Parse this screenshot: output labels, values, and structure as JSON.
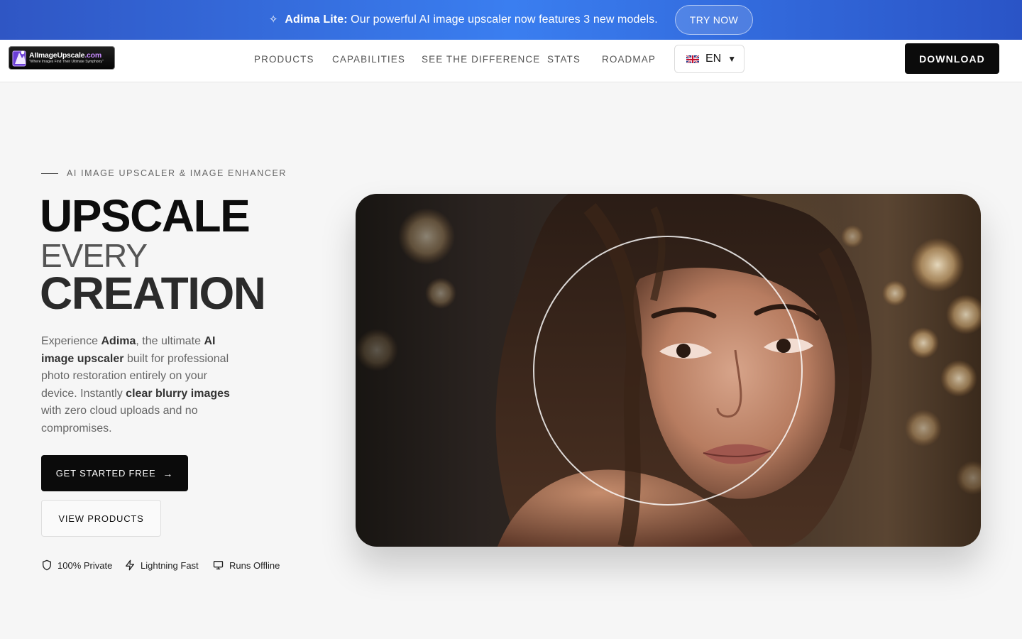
{
  "banner": {
    "icon": "sparkle-icon",
    "highlight": "Adima Lite:",
    "message": " Our powerful AI image upscaler now features 3 new models.",
    "cta": "TRY NOW"
  },
  "header": {
    "logo": {
      "name_main": "AIImageUpscale",
      "name_suffix": ".com",
      "tagline": "\"Where Images Find Their Ultimate Symphony\""
    },
    "nav": [
      "PRODUCTS",
      "CAPABILITIES",
      "SEE THE DIFFERENCE",
      "STATS",
      "ROADMAP"
    ],
    "language": {
      "flag": "uk-flag-icon",
      "code": "EN"
    },
    "download": "DOWNLOAD"
  },
  "hero": {
    "eyebrow": "AI IMAGE UPSCALER & IMAGE ENHANCER",
    "headline": [
      "UPSCALE",
      "EVERY",
      "CREATION"
    ],
    "description": {
      "t1": "Experience ",
      "b1": "Adima",
      "t2": ", the ultimate ",
      "b2": "AI image upscaler",
      "t3": " built for professional photo restoration entirely on your device. Instantly ",
      "b3": "clear blurry images",
      "t4": " with zero cloud uploads and no compromises."
    },
    "primary_cta": "GET STARTED FREE",
    "secondary_cta": "VIEW PRODUCTS",
    "features": [
      {
        "icon": "shield-icon",
        "label": "100% Private"
      },
      {
        "icon": "lightning-icon",
        "label": "Lightning Fast"
      },
      {
        "icon": "monitor-icon",
        "label": "Runs Offline"
      }
    ]
  },
  "colors": {
    "banner_gradient": [
      "#2f56c4",
      "#3a7ef0"
    ],
    "primary_button": "#0b0b0b",
    "page_background": "#f6f6f6"
  }
}
